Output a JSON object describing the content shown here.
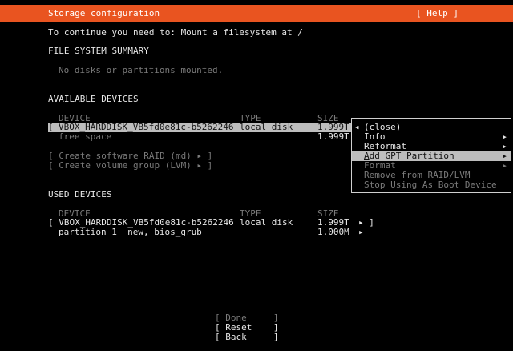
{
  "header": {
    "title": "Storage configuration",
    "help": "[ Help ]"
  },
  "intro": "To continue you need to: Mount a filesystem at /",
  "fs_summary": {
    "heading": "FILE SYSTEM SUMMARY",
    "empty": "No disks or partitions mounted."
  },
  "available": {
    "heading": "AVAILABLE DEVICES",
    "col_device": "DEVICE",
    "col_type": "TYPE",
    "col_size": "SIZE",
    "disk_bracket": "[",
    "disk_name": "VBOX_HARDDISK_VB5fd0e81c-b5262246",
    "disk_type": "local disk",
    "disk_size": "1.999T",
    "free_label": "free space",
    "free_size": "1.999T",
    "raid": "[ Create software RAID (md) ▸ ]",
    "lvm": "[ Create volume group (LVM) ▸ ]"
  },
  "menu": {
    "close": "(close)",
    "close_marker": "◂",
    "items": [
      {
        "label": "Info",
        "arrow": "▸"
      },
      {
        "label": "Reformat",
        "arrow": "▸"
      },
      {
        "label_ul": "A",
        "label_rest": "dd GPT Partition",
        "arrow": "▸"
      },
      {
        "label": "Format",
        "arrow": "▸"
      },
      {
        "label": "Remove from RAID/LVM"
      },
      {
        "label": "Stop Using As Boot Device"
      }
    ]
  },
  "used": {
    "heading": "USED DEVICES",
    "col_device": "DEVICE",
    "col_type": "TYPE",
    "col_size": "SIZE",
    "disk_row": "[ VBOX_HARDDISK_VB5fd0e81c-b5262246",
    "disk_type": "local disk",
    "disk_size": "1.999T",
    "disk_action": "▸ ]",
    "part_label": "partition 1  new, bios_grub",
    "part_size": "1.000M",
    "part_action": "▸"
  },
  "footer": {
    "done": "[ Done     ]",
    "reset": "[ Reset    ]",
    "back": "[ Back     ]"
  }
}
